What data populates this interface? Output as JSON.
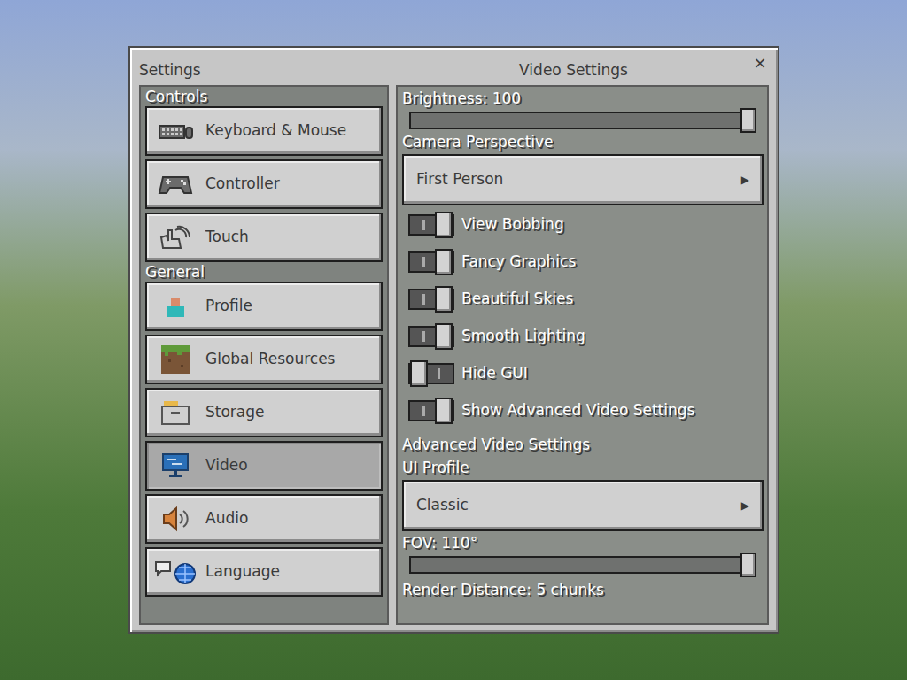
{
  "window": {
    "title": "Settings",
    "panel_title": "Video Settings",
    "close": "×"
  },
  "sidebar": {
    "sections": [
      {
        "heading": "Controls",
        "items": [
          {
            "label": "Keyboard & Mouse",
            "selected": false
          },
          {
            "label": "Controller",
            "selected": false
          },
          {
            "label": "Touch",
            "selected": false
          }
        ]
      },
      {
        "heading": "General",
        "items": [
          {
            "label": "Profile",
            "selected": false
          },
          {
            "label": "Global Resources",
            "selected": false
          },
          {
            "label": "Storage",
            "selected": false
          },
          {
            "label": "Video",
            "selected": true
          },
          {
            "label": "Audio",
            "selected": false
          },
          {
            "label": "Language",
            "selected": false
          }
        ]
      }
    ]
  },
  "settings": [
    {
      "kind": "slider",
      "label": "Brightness: 100",
      "level": 1
    },
    {
      "kind": "dropdown",
      "label": "Camera Perspective",
      "value": "First Person",
      "arrow": "▶"
    },
    {
      "kind": "toggle",
      "label": "View Bobbing",
      "on": true
    },
    {
      "kind": "toggle",
      "label": "Fancy Graphics",
      "on": true
    },
    {
      "kind": "toggle",
      "label": "Beautiful Skies",
      "on": true
    },
    {
      "kind": "toggle",
      "label": "Smooth Lighting",
      "on": true
    },
    {
      "kind": "toggle",
      "label": "Hide GUI",
      "on": false
    },
    {
      "kind": "toggle",
      "label": "Show Advanced Video Settings",
      "on": true
    },
    {
      "kind": "heading",
      "label": "Advanced Video Settings"
    },
    {
      "kind": "dropdown",
      "label": "UI Profile",
      "value": "Classic",
      "arrow": "▶"
    },
    {
      "kind": "slider",
      "label": "FOV: 110°",
      "level": 1
    },
    {
      "kind": "heading",
      "label": "Render Distance: 5 chunks"
    }
  ]
}
